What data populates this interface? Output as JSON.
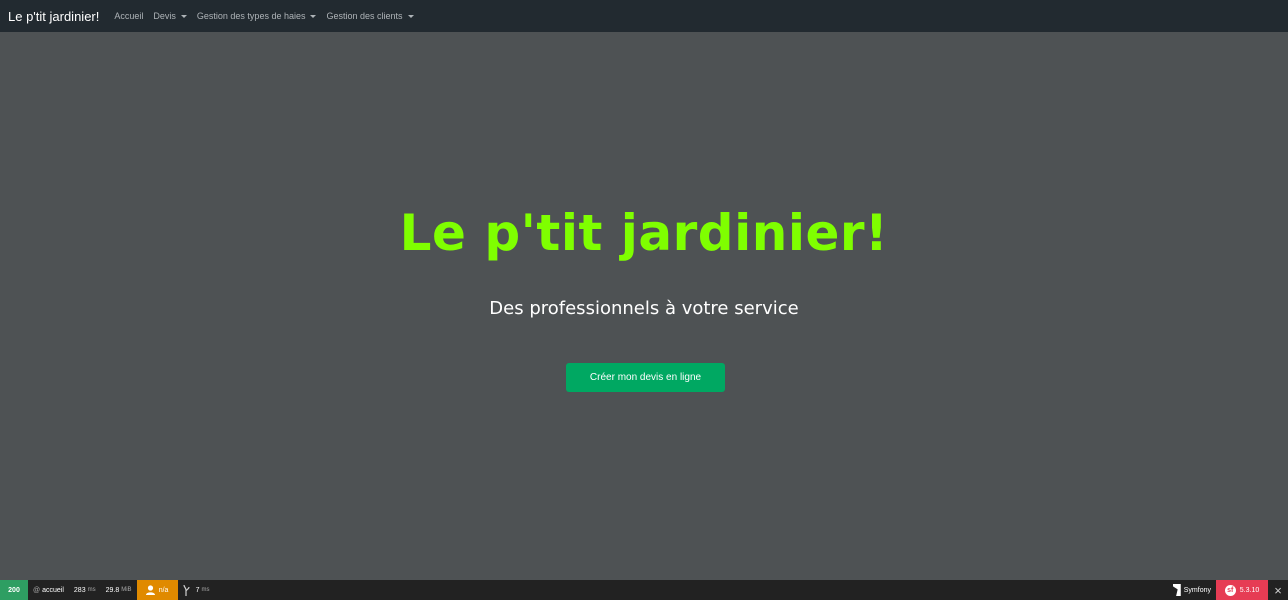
{
  "navbar": {
    "brand": "Le p'tit jardinier!",
    "items": [
      {
        "label": "Accueil",
        "dropdown": false
      },
      {
        "label": "Devis",
        "dropdown": true
      },
      {
        "label": "Gestion des types de haies",
        "dropdown": true
      },
      {
        "label": "Gestion des clients",
        "dropdown": true
      }
    ]
  },
  "hero": {
    "title": "Le p'tit jardinier!",
    "subtitle": "Des professionnels à votre service",
    "button": "Créer mon devis en ligne"
  },
  "toolbar": {
    "status": "200",
    "route": "accueil",
    "time": "283",
    "time_unit": "ms",
    "memory": "29.8",
    "memory_unit": "MiB",
    "user": "n/a",
    "twig_time": "7",
    "twig_unit": "ms",
    "symfony_label": "Symfony",
    "version": "5.3.10",
    "icons": {
      "route": "at-icon",
      "user": "user-icon",
      "twig": "twig-icon",
      "symfony": "symfony-icon",
      "version": "symfony-logo-icon",
      "close": "close-icon"
    }
  },
  "colors": {
    "background": "#4e5254",
    "navbar": "#222a30",
    "title": "#7fff00",
    "button": "#00a862",
    "toolbar": "#222222",
    "status_ok": "#2e9e62",
    "user_badge": "#e08a00",
    "version_badge": "#e63c54"
  }
}
